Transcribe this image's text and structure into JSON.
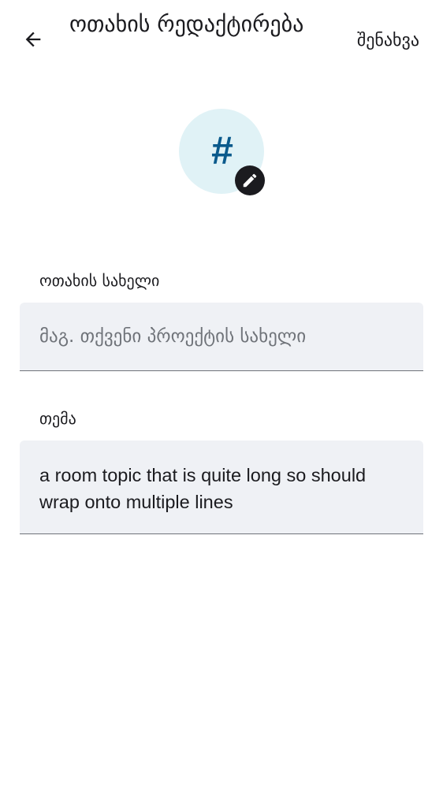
{
  "header": {
    "back_icon": "arrow-left-icon",
    "title": "ოთახის რედაქტირება",
    "save_label": "შენახვა"
  },
  "avatar": {
    "glyph": "#",
    "background": "#e0f2f6",
    "glyph_color": "#0a5a8c",
    "edit_icon": "pencil-icon"
  },
  "room_name": {
    "label": "ოთახის სახელი",
    "value": "",
    "placeholder": "მაგ. თქვენი პროექტის სახელი"
  },
  "topic": {
    "label": "თემა",
    "value": "a room topic that is quite long so should wrap onto multiple lines"
  }
}
